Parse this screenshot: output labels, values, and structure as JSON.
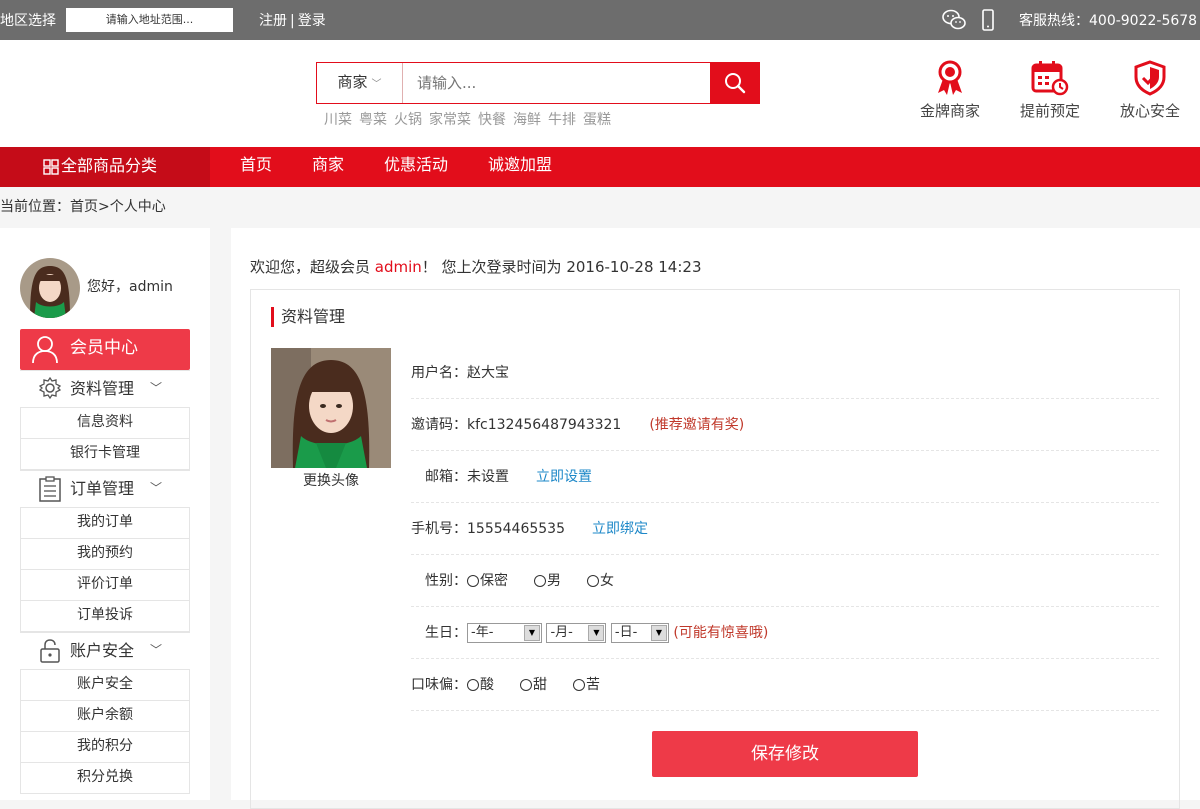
{
  "topbar": {
    "region_label": "地区选择",
    "address_placeholder": "请输入地址范围...",
    "register": "注册",
    "separator": "|",
    "login": "登录",
    "hotline": "客服热线：400-9022-5678"
  },
  "search": {
    "category": "商家",
    "placeholder": "请输入...",
    "hot_words": [
      "川菜",
      "粤菜",
      "火锅",
      "家常菜",
      "快餐",
      "海鲜",
      "牛排",
      "蛋糕"
    ]
  },
  "features": [
    {
      "label": "金牌商家",
      "icon": "award-ribbon-icon"
    },
    {
      "label": "提前预定",
      "icon": "calendar-clock-icon"
    },
    {
      "label": "放心安全",
      "icon": "shield-check-icon"
    }
  ],
  "nav": {
    "all_categories": "全部商品分类",
    "items": [
      "首页",
      "商家",
      "优惠活动",
      "诚邀加盟"
    ]
  },
  "breadcrumb": "当前位置：首页>个人中心",
  "sidebar": {
    "greeting": "您好，admin",
    "member_center": "会员中心",
    "groups": [
      {
        "title": "资料管理",
        "icon": "gear-icon",
        "items": [
          "信息资料",
          "银行卡管理"
        ]
      },
      {
        "title": "订单管理",
        "icon": "clipboard-icon",
        "items": [
          "我的订单",
          "我的预约",
          "评价订单",
          "订单投诉"
        ]
      },
      {
        "title": "账户安全",
        "icon": "lock-icon",
        "items": [
          "账户安全",
          "账户余额",
          "我的积分",
          "积分兑换"
        ]
      }
    ]
  },
  "main": {
    "welcome_prefix": "欢迎您，超级会员 ",
    "welcome_user": "admin",
    "welcome_suffix": "！ 您上次登录时间为 2016-10-28 14:23",
    "panel_title": "资料管理",
    "change_avatar": "更换头像",
    "username_label": "用户名：",
    "username": "赵大宝",
    "invite_label": "邀请码：",
    "invite_code": "kfc132456487943321",
    "invite_note": "(推荐邀请有奖)",
    "email_label": "邮箱：",
    "email_value": "未设置",
    "email_action": "立即设置",
    "phone_label": "手机号：",
    "phone_value": "15554465535",
    "phone_action": "立即绑定",
    "gender_label": "性别：",
    "gender_options": [
      "保密",
      "男",
      "女"
    ],
    "birthday_label": "生日：",
    "year_select": "-年-",
    "month_select": "-月-",
    "day_select": "-日-",
    "birthday_note": "(可能有惊喜哦)",
    "taste_label": "口味偏：",
    "taste_options": [
      "酸",
      "甜",
      "苦"
    ],
    "save_button": "保存修改"
  },
  "colors": {
    "brand_red": "#e20d1b",
    "button_red": "#ee3a48",
    "link_blue": "#1e88c8",
    "topbar_gray": "#6d6d6d"
  }
}
